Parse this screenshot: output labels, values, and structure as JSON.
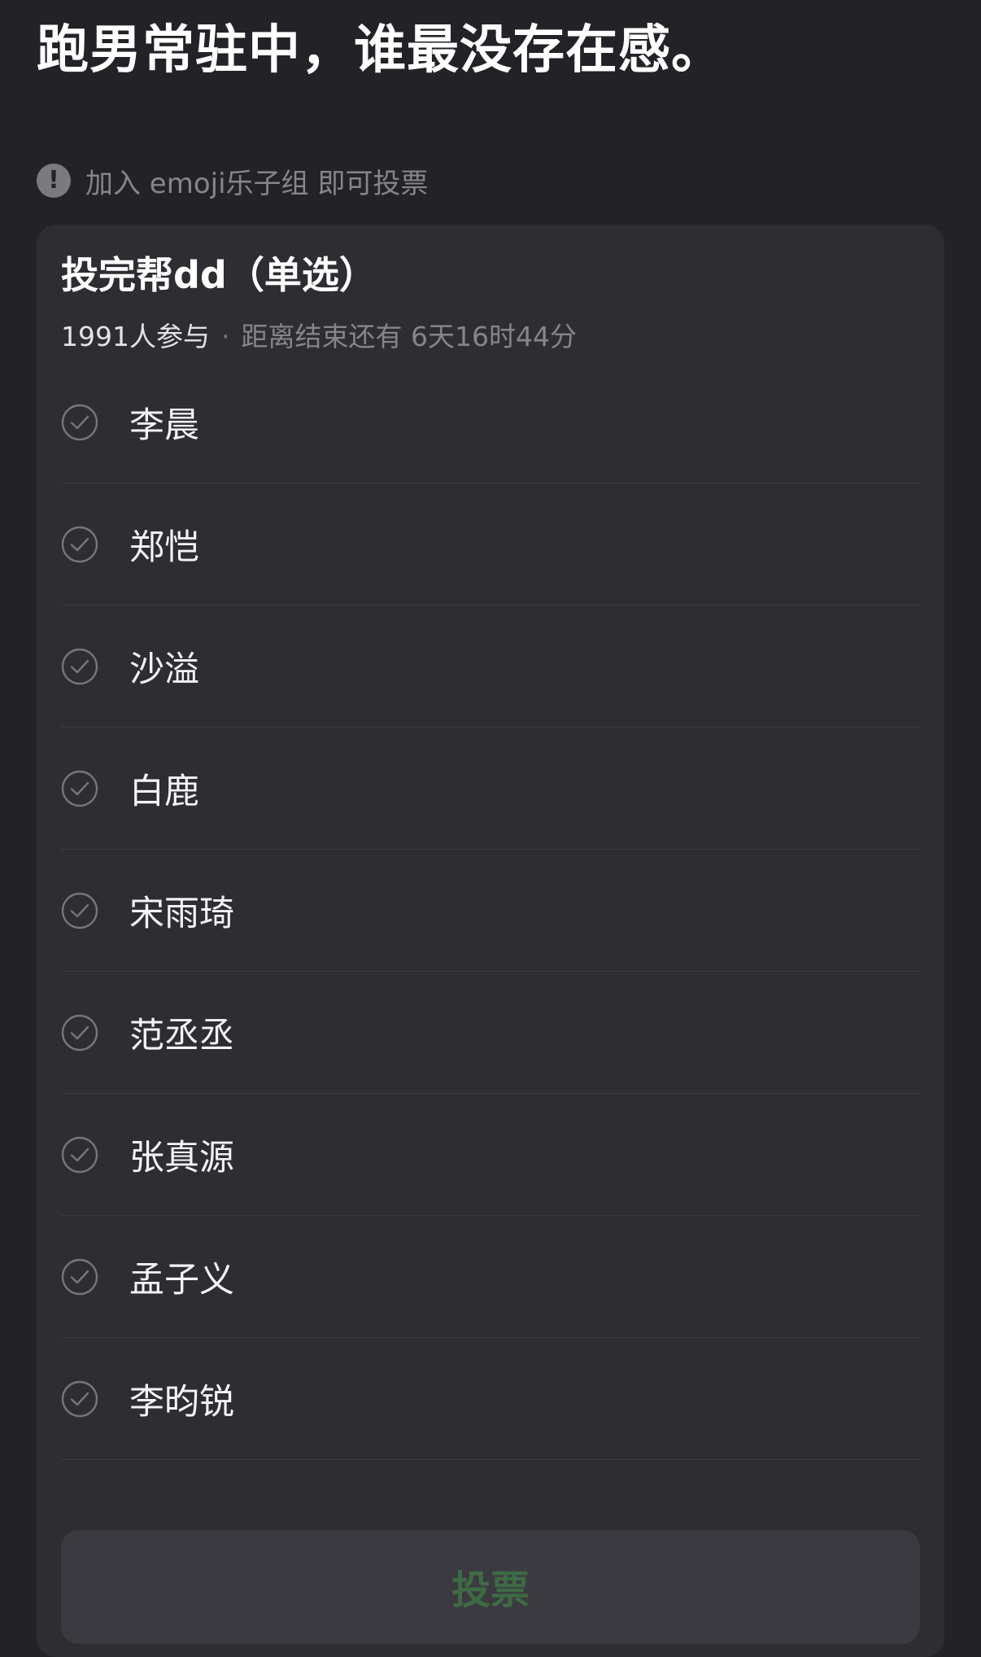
{
  "header": {
    "title": "跑男常驻中，谁最没存在感。"
  },
  "notice": {
    "icon": "exclamation-circle-icon",
    "text": "加入 emoji乐子组 即可投票"
  },
  "poll": {
    "title": "投完帮dd（单选）",
    "participants": "1991人参与",
    "separator": "·",
    "remaining": "距离结束还有 6天16时44分",
    "options": [
      {
        "label": "李晨"
      },
      {
        "label": "郑恺"
      },
      {
        "label": "沙溢"
      },
      {
        "label": "白鹿"
      },
      {
        "label": "宋雨琦"
      },
      {
        "label": "范丞丞"
      },
      {
        "label": "张真源"
      },
      {
        "label": "孟子义"
      },
      {
        "label": "李昀锐"
      }
    ],
    "vote_label": "投票"
  },
  "colors": {
    "background": "#232227",
    "card": "#2e2d32",
    "vote_button_bg": "#3b3a40",
    "vote_text": "#3e6a44"
  }
}
